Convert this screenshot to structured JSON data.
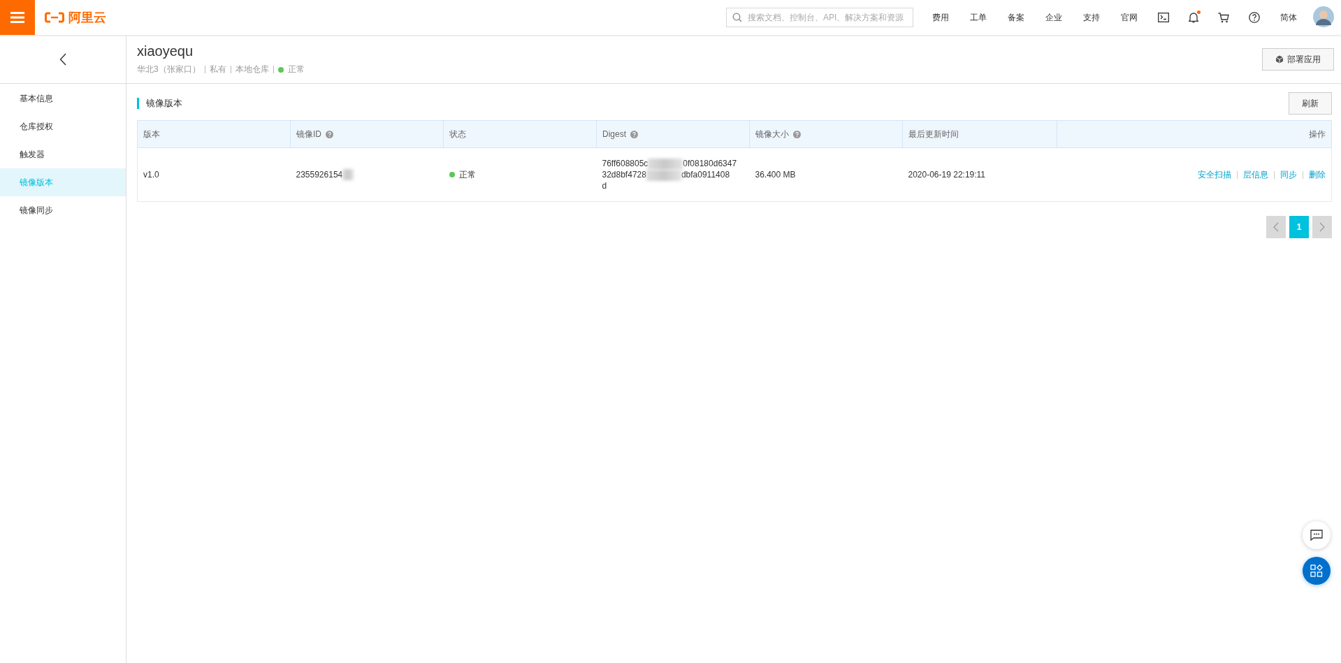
{
  "topbar": {
    "logo": "阿里云",
    "search": {
      "placeholder": "搜索文档、控制台、API、解决方案和资源"
    },
    "nav": [
      "费用",
      "工单",
      "备案",
      "企业",
      "支持",
      "官网"
    ],
    "notification_dot": true,
    "language": "简体"
  },
  "sidebar": {
    "items": [
      {
        "label": "基本信息",
        "selected": false
      },
      {
        "label": "仓库授权",
        "selected": false
      },
      {
        "label": "触发器",
        "selected": false
      },
      {
        "label": "镜像版本",
        "selected": true
      },
      {
        "label": "镜像同步",
        "selected": false
      }
    ]
  },
  "header": {
    "title": "xiaoyequ",
    "meta": [
      "华北3（张家口）",
      "私有",
      "本地仓库"
    ],
    "status": "正常",
    "color": "#5cc75c",
    "deploy_button": "部署应用"
  },
  "section": {
    "title": "镜像版本",
    "refresh_button": "刷新"
  },
  "table": {
    "columns": [
      {
        "label": "版本",
        "help": false
      },
      {
        "label": "镜像ID",
        "help": true
      },
      {
        "label": "状态",
        "help": false
      },
      {
        "label": "Digest",
        "help": true
      },
      {
        "label": "镜像大小",
        "help": true
      },
      {
        "label": "最后更新时间",
        "help": false
      },
      {
        "label": "操作",
        "help": false
      }
    ],
    "rows": [
      {
        "version": "v1.0",
        "image_id": "2355926154",
        "status": "正常",
        "color": "#5cc75c",
        "digest_lines": [
          [
            "76ff608805c",
            "0f08180d6347"
          ],
          [
            "32d8bf4728",
            "dbfa0911408"
          ],
          [
            "d"
          ]
        ],
        "size": "36.400 MB",
        "updated": "2020-06-19 22:19:11",
        "actions": [
          "安全扫描",
          "层信息",
          "同步",
          "删除"
        ]
      }
    ]
  },
  "pagination": {
    "pages": [
      {
        "label": "1",
        "selected": true
      }
    ]
  }
}
